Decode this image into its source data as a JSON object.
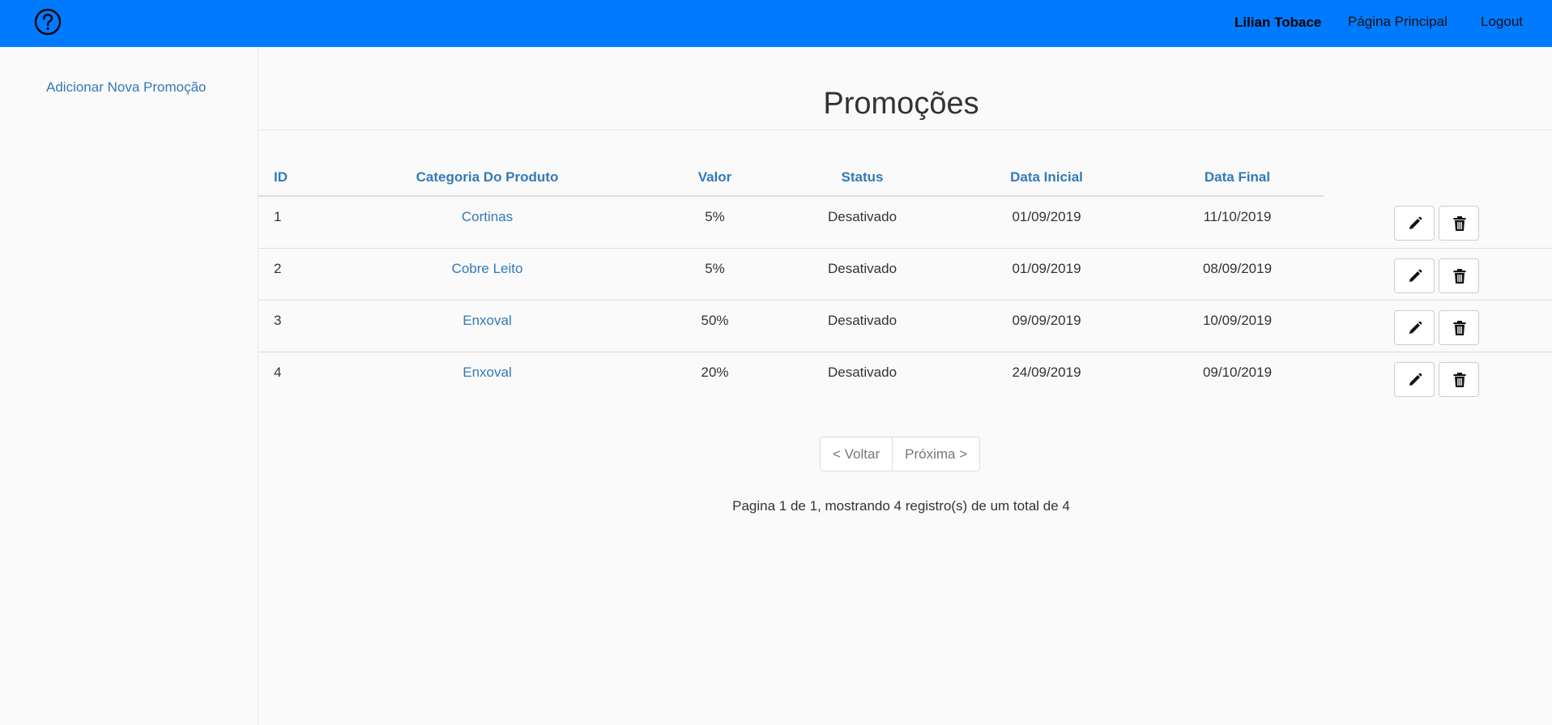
{
  "navbar": {
    "help_icon": "question-circle-icon",
    "user_name": "Lilian Tobace",
    "home_label": "Página Principal",
    "logout_label": "Logout",
    "color": "#007bff"
  },
  "sidebar": {
    "add_promo_label": "Adicionar Nova Promoção"
  },
  "main": {
    "title": "Promoções",
    "table": {
      "headers": {
        "id": "ID",
        "category": "Categoria Do Produto",
        "value": "Valor",
        "status": "Status",
        "start": "Data Inicial",
        "end": "Data Final"
      },
      "rows": [
        {
          "id": "1",
          "category": "Cortinas",
          "value": "5%",
          "status": "Desativado",
          "start": "01/09/2019",
          "end": "11/10/2019"
        },
        {
          "id": "2",
          "category": "Cobre Leito",
          "value": "5%",
          "status": "Desativado",
          "start": "01/09/2019",
          "end": "08/09/2019"
        },
        {
          "id": "3",
          "category": "Enxoval",
          "value": "50%",
          "status": "Desativado",
          "start": "09/09/2019",
          "end": "10/09/2019"
        },
        {
          "id": "4",
          "category": "Enxoval",
          "value": "20%",
          "status": "Desativado",
          "start": "24/09/2019",
          "end": "09/10/2019"
        }
      ],
      "row_actions": [
        "pencil-icon",
        "trash-icon"
      ]
    },
    "pagination": {
      "prev_label": "< Voltar",
      "next_label": "Próxima >"
    },
    "page_info": "Pagina 1 de 1, mostrando 4 registro(s) de um total de 4"
  }
}
